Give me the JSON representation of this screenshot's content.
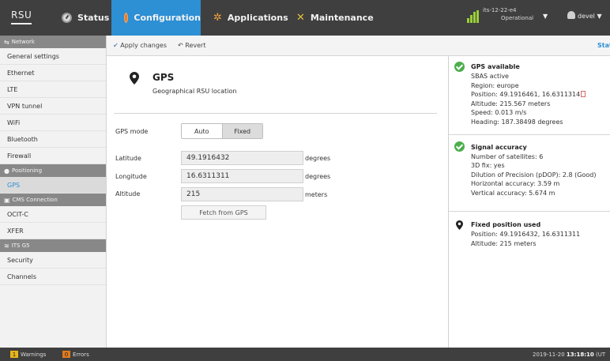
{
  "header": {
    "brand": "RSU",
    "tabs": [
      {
        "label": "Status",
        "icon": "gauge-icon"
      },
      {
        "label": "Configuration",
        "icon": "gear-icon"
      },
      {
        "label": "Applications",
        "icon": "puzzle-icon"
      },
      {
        "label": "Maintenance",
        "icon": "tools-icon"
      }
    ],
    "active_tab": "Configuration",
    "device": {
      "name": "its-12-22-e4",
      "state": "Operational"
    },
    "user": "devel"
  },
  "sidebar": {
    "sections": [
      {
        "label": "Network",
        "items": [
          "General settings",
          "Ethernet",
          "LTE",
          "VPN tunnel",
          "WiFi",
          "Bluetooth",
          "Firewall"
        ]
      },
      {
        "label": "Positioning",
        "items": [
          "GPS"
        ]
      },
      {
        "label": "CMS Connection",
        "items": [
          "OCIT-C",
          "XFER"
        ]
      },
      {
        "label": "ITS G5",
        "items": [
          "Security",
          "Channels"
        ]
      }
    ],
    "active_item": "GPS"
  },
  "toolbar": {
    "apply": "Apply changes",
    "revert": "Revert",
    "status_tab": "Stat"
  },
  "form": {
    "title": "GPS",
    "subtitle": "Geographical RSU location",
    "mode_label": "GPS mode",
    "mode_options": [
      "Auto",
      "Fixed"
    ],
    "mode_selected": "Fixed",
    "latitude": {
      "label": "Latitude",
      "value": "49.1916432",
      "unit": "degrees"
    },
    "longitude": {
      "label": "Longitude",
      "value": "16.6311311",
      "unit": "degrees"
    },
    "altitude": {
      "label": "Altitude",
      "value": "215",
      "unit": "meters"
    },
    "fetch_button": "Fetch from GPS"
  },
  "status_panel": {
    "cards": [
      {
        "title": "GPS available",
        "lines": [
          "SBAS active",
          "Region: europe",
          "Position: 49.1916461, 16.6311314",
          "Altitude: 215.567 meters",
          "Speed: 0.013 m/s",
          "Heading: 187.38498 degrees"
        ]
      },
      {
        "title": "Signal accuracy",
        "lines": [
          "Number of satellites: 6",
          "3D fix: yes",
          "Dilution of Precision (pDOP): 2.8 (Good)",
          "Horizontal accuracy: 3.59 m",
          "Vertical accuracy: 5.674 m"
        ]
      },
      {
        "title": "Fixed position used",
        "lines": [
          "Position: 49.1916432, 16.6311311",
          "Altitude: 215 meters"
        ]
      }
    ]
  },
  "footer": {
    "warnings_count": "1",
    "warnings_label": "Warnings",
    "errors_count": "0",
    "errors_label": "Errors",
    "date": "2019-11-20",
    "time": "13:18:10",
    "tz_fragment": "(UT"
  },
  "colors": {
    "accent": "#2d8fd4",
    "ok": "#4cae4c",
    "topbar": "#3f3f3f",
    "warning": "#e8b61a",
    "error": "#e07b1d"
  }
}
